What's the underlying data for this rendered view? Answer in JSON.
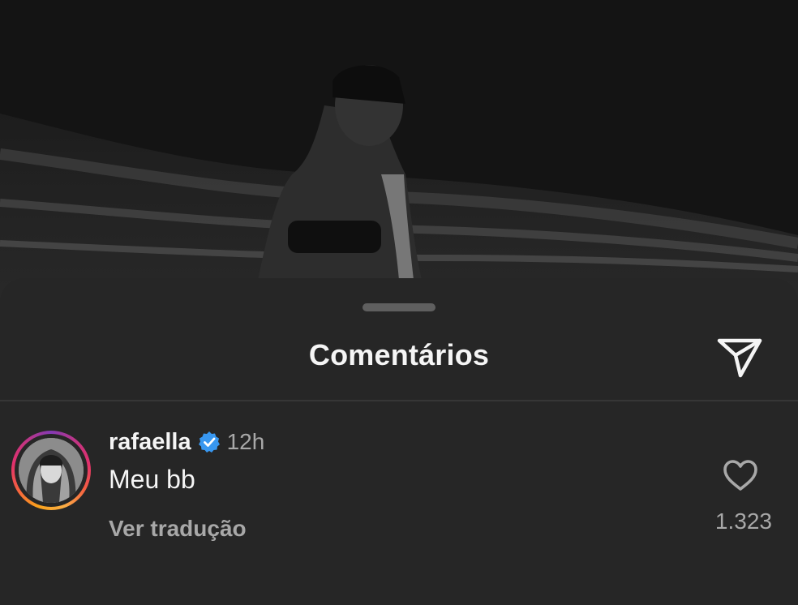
{
  "sheet": {
    "title": "Comentários",
    "share_icon": "paper-plane-icon"
  },
  "comment": {
    "username": "rafaella",
    "verified_icon": "verified-badge-icon",
    "time": "12h",
    "text": "Meu bb",
    "translate_label": "Ver tradução",
    "like_icon": "heart-icon",
    "like_count": "1.323"
  },
  "colors": {
    "sheet_background": "#262626",
    "verified_blue": "#3897f0",
    "secondary_text": "#a8a8a8"
  }
}
